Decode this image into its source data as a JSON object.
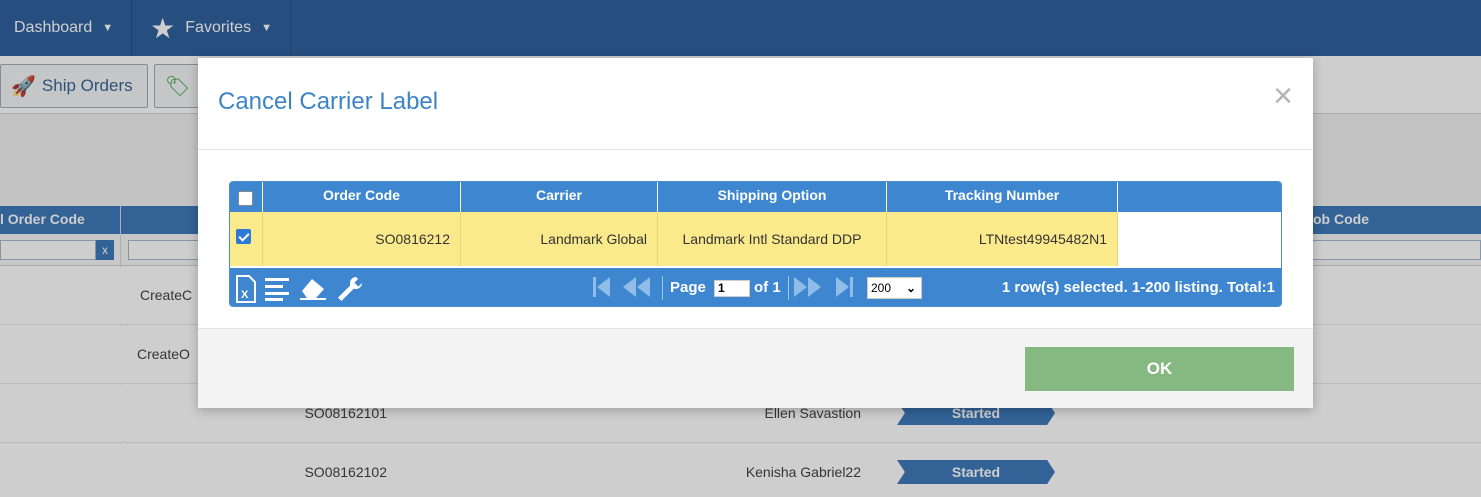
{
  "topbar": {
    "dashboard_label": "Dashboard",
    "favorites_label": "Favorites"
  },
  "toolbar": {
    "ship_orders_label": "Ship Orders"
  },
  "background_grid": {
    "col_order_code": "l Order Code",
    "col_job_code": "ob Code",
    "filter_clear": "x",
    "rows": [
      {
        "create": "CreateC",
        "code": "",
        "customer": "",
        "status": ""
      },
      {
        "create": "CreateO",
        "code": "",
        "customer": "",
        "status": ""
      },
      {
        "create": "",
        "code": "SO08162101",
        "customer": "Ellen Savastion",
        "status": "Started"
      },
      {
        "create": "",
        "code": "SO08162102",
        "customer": "Kenisha Gabriel22",
        "status": "Started"
      }
    ]
  },
  "modal": {
    "title": "Cancel Carrier Label",
    "close_symbol": "×",
    "columns": {
      "order_code": "Order Code",
      "carrier": "Carrier",
      "shipping_option": "Shipping Option",
      "tracking_number": "Tracking Number"
    },
    "row": {
      "order_code": "SO0816212",
      "carrier": "Landmark Global",
      "shipping_option": "Landmark Intl Standard DDP",
      "tracking_number": "LTNtest49945482N1",
      "selected": true
    },
    "pager": {
      "page_label": "Page",
      "page_value": "1",
      "of_label": "of 1",
      "page_size": "200",
      "status": "1 row(s) selected. 1-200 listing. Total:1"
    },
    "ok_label": "OK"
  },
  "colors": {
    "topbar": "#1f5596",
    "grid_header": "#3e87d0",
    "selected_row": "#fbea8b",
    "ok_button": "#86b981",
    "title": "#3d84c6"
  }
}
